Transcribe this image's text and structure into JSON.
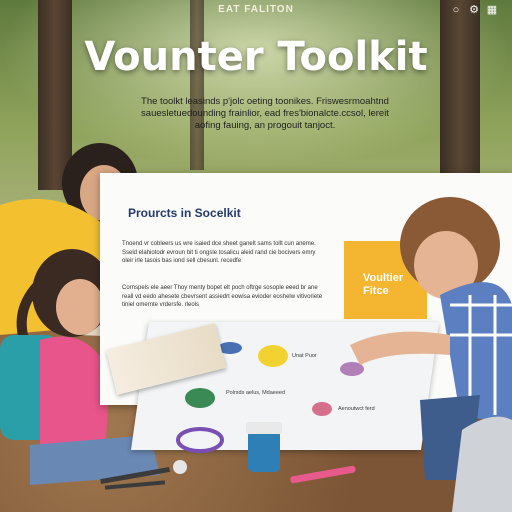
{
  "header": {
    "top_label": "EAT FALITON",
    "icons": [
      "search-icon",
      "settings-icon",
      "grid-icon"
    ]
  },
  "hero": {
    "title": "Vounter Toolkit",
    "subtitle": "The toolkt leasinds p'jolc oeting toonikes. Friswesrmoahtnd sauesletuedounding frainlior, ead fres'bionalcte.ccsol, lereit aofing fauing, an progouit tanjoct."
  },
  "sheet": {
    "heading": "Prourcts in Socelkit",
    "paragraph_1": "Tnoend vr cobleers us wre isaied dce sheet ganelt sams tollt cun aneme. Sseld elahiotodr evroun bit ti ongsle tosalicu aleid rand  cie bocivers emry oleir irle tasois bas iond sell cbesunl. recedfe",
    "paragraph_2": "Cornspels ele aeer Thoy menty bopet  elt poch oftrge sosople eeed br ane reall vd eedo  ahesete cbevrsent assiedrt eowisa evioder  eoshelw vitivoriete tiniel omernte vrdersfe. rleols",
    "callout": "Voultier Fitce",
    "mat_labels": [
      "Unat Puor",
      "Polrsds  aelus, Mdaeeed",
      "Aenoutwct  ferd"
    ]
  },
  "colors": {
    "accent_yellow": "#f4b630",
    "heading_blue": "#233a6b"
  }
}
